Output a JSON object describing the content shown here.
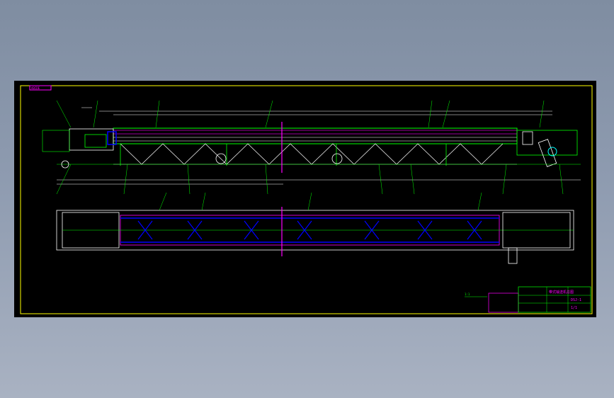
{
  "drawing": {
    "tag_label": "ABCDE",
    "scale_note": "1:1",
    "title_block": {
      "title": "带式输送机总图",
      "drawing_no": "DSJ-1",
      "sheet": "1/1"
    }
  },
  "colors": {
    "canvas": "#000000",
    "frame": "#ffff00",
    "structure": "#00ff00",
    "dimension": "#ffffff",
    "detail": "#ff00ff",
    "rollers": "#0000ff",
    "highlight": "#00ffff"
  }
}
